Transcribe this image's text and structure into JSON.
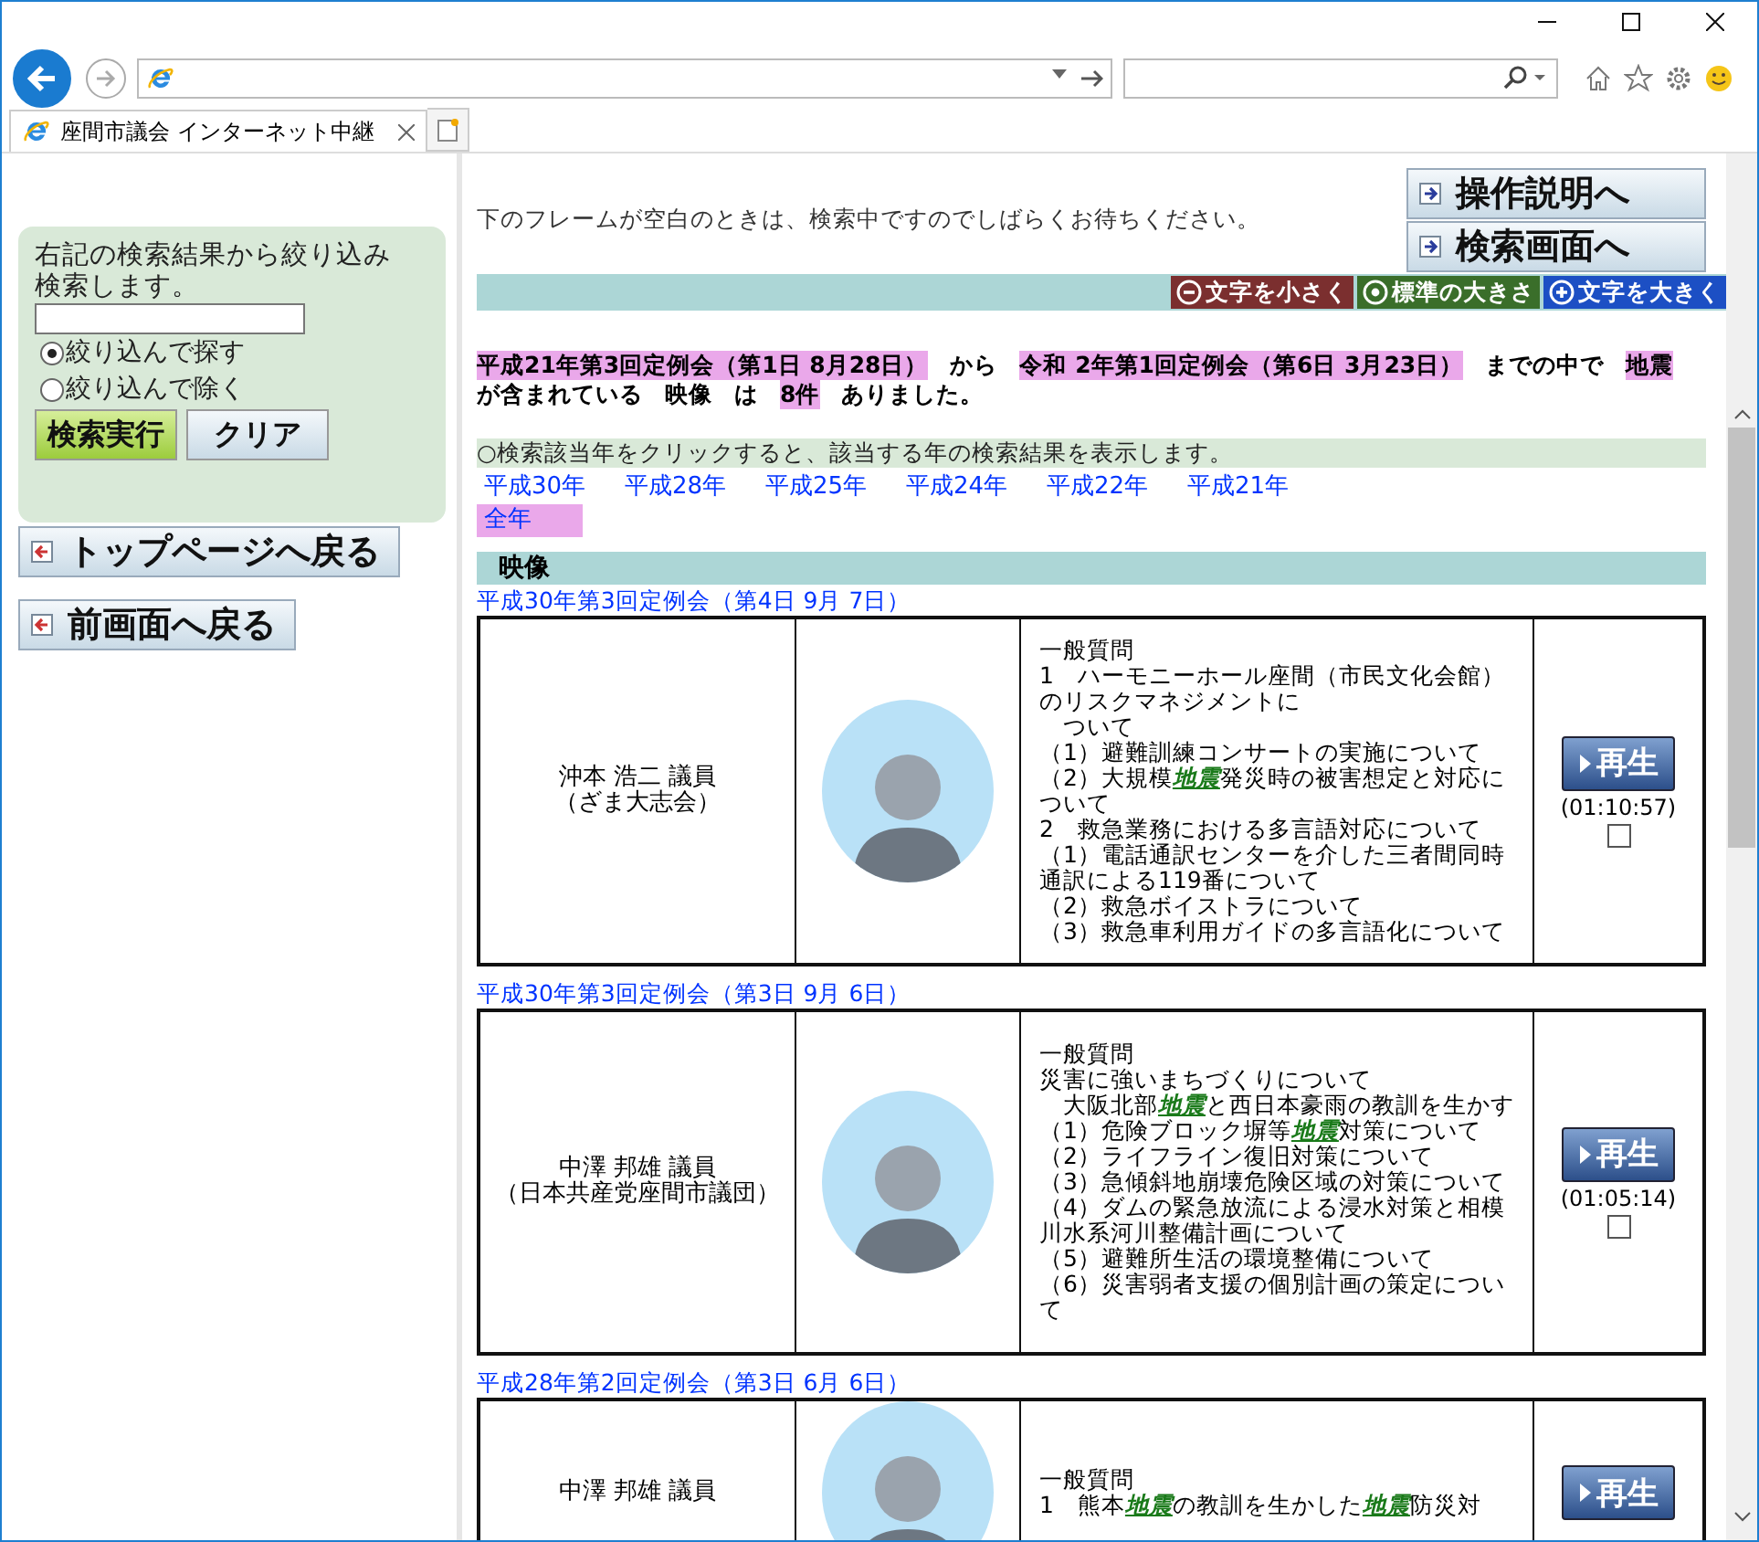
{
  "browser": {
    "tab_title": "座間市議会 インターネット中継"
  },
  "sidebar": {
    "intro": "右記の検索結果から絞り込み検索します。",
    "radios": [
      {
        "label": "絞り込んで探す",
        "selected": true
      },
      {
        "label": "絞り込んで除く",
        "selected": false
      }
    ],
    "buttons": [
      {
        "label": "検索実行",
        "kind": "primary"
      },
      {
        "label": "クリア",
        "kind": "secondary"
      }
    ],
    "nav_buttons": [
      "トップページへ戻る",
      "前画面へ戻る"
    ]
  },
  "header": {
    "notice": "下のフレームが空白のときは、検索中ですのでしばらくお待ちください。",
    "nav_buttons": [
      "操作説明へ",
      "検索画面へ"
    ],
    "font_buttons": [
      {
        "label": "文字を小さく",
        "kind": "minus",
        "color": "#7b2f2f"
      },
      {
        "label": "標準の大きさ",
        "kind": "dot",
        "color": "#3a6e2a"
      },
      {
        "label": "文字を大きく",
        "kind": "plus",
        "color": "#1c4fc4"
      }
    ]
  },
  "summary": [
    {
      "text": "平成21年第3回定例会（第1日 8月28日）",
      "highlight": true
    },
    {
      "text": "から",
      "highlight": false
    },
    {
      "text": "令和 2年第1回定例会（第6日 3月23日）",
      "highlight": true
    },
    {
      "text": "までの中で",
      "highlight": false
    },
    {
      "text": "地震",
      "highlight": true
    },
    {
      "text": "が含まれている",
      "highlight": false
    },
    {
      "text": "映像",
      "highlight": false
    },
    {
      "text": "は",
      "highlight": false
    },
    {
      "text": "8件",
      "highlight": true
    },
    {
      "text": "ありました。",
      "highlight": false
    }
  ],
  "year_hint": "○検索該当年をクリックすると、該当する年の検索結果を表示します。",
  "years": [
    {
      "label": "平成30年",
      "selected": false
    },
    {
      "label": "平成28年",
      "selected": false
    },
    {
      "label": "平成25年",
      "selected": false
    },
    {
      "label": "平成24年",
      "selected": false
    },
    {
      "label": "平成22年",
      "selected": false
    },
    {
      "label": "平成21年",
      "selected": false
    },
    {
      "label": "全年",
      "selected": true
    }
  ],
  "section_title": "映像",
  "results": [
    {
      "session": "平成30年第3回定例会（第4日 9月 7日）",
      "speaker": "沖本 浩二 議員",
      "faction": "（ざま大志会）",
      "questions": [
        "一般質問",
        "1　ハーモニーホール座間（市民文化会館）のリスクマネジメントに",
        "　ついて",
        "（1）避難訓練コンサートの実施について",
        "（2）大規模**地震**発災時の被害想定と対応について",
        "2　救急業務における多言語対応について",
        "（1）電話通訳センターを介した三者間同時通訳による119番について",
        "（2）救急ボイストラについて",
        "（3）救急車利用ガイドの多言語化について"
      ],
      "play_label": "再生",
      "duration": "(01:10:57)",
      "checked": false
    },
    {
      "session": "平成30年第3回定例会（第3日 9月 6日）",
      "speaker": "中澤 邦雄 議員",
      "faction": "（日本共産党座間市議団）",
      "questions": [
        "一般質問",
        "災害に強いまちづくりについて",
        "　大阪北部**地震**と西日本豪雨の教訓を生かす",
        "（1）危険ブロック塀等**地震**対策について",
        "（2）ライフライン復旧対策について",
        "（3）急傾斜地崩壊危険区域の対策について",
        "（4）ダムの緊急放流による浸水対策と相模川水系河川整備計画について",
        "（5）避難所生活の環境整備について",
        "（6）災害弱者支援の個別計画の策定について"
      ],
      "play_label": "再生",
      "duration": "(01:05:14)",
      "checked": false
    },
    {
      "session": "平成28年第2回定例会（第3日 6月 6日）",
      "speaker": "中澤 邦雄 議員",
      "questions": [
        "一般質問",
        "1　熊本**地震**の教訓を生かした**地震**防災対"
      ],
      "play_label": "再生"
    }
  ]
}
